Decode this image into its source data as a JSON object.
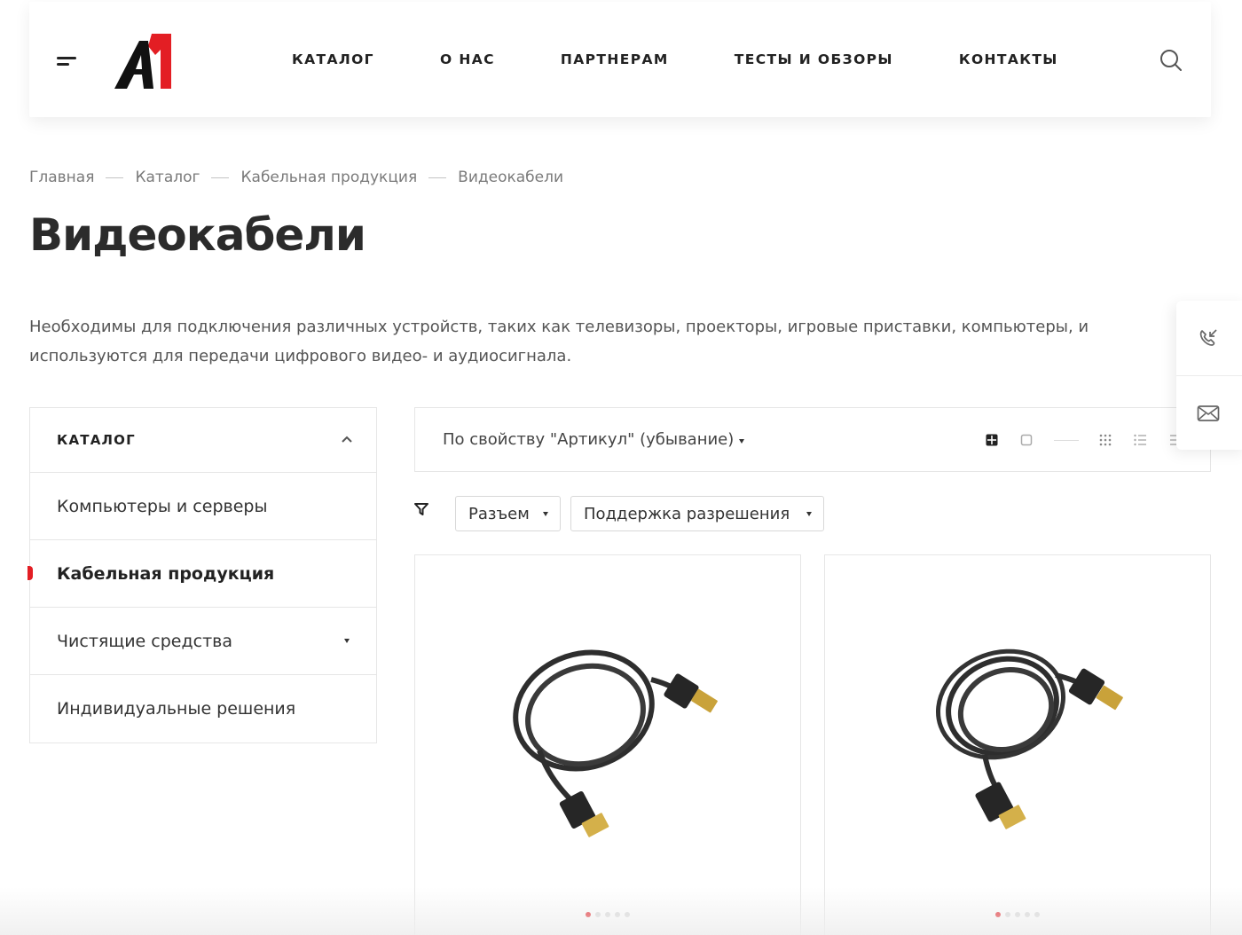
{
  "header": {
    "nav": [
      "КАТАЛОГ",
      "О НАС",
      "ПАРТНЕРАМ",
      "ТЕСТЫ И ОБЗОРЫ",
      "КОНТАКТЫ"
    ],
    "logo_text": "A1"
  },
  "breadcrumb": [
    "Главная",
    "Каталог",
    "Кабельная продукция",
    "Видеокабели"
  ],
  "page": {
    "title": "Видеокабели",
    "description": "Необходимы для подключения различных устройств, таких как телевизоры, проекторы, игровые приставки, компьютеры, и используются для передачи цифрового видео- и аудиосигнала."
  },
  "catalog": {
    "title": "КАТАЛОГ",
    "items": [
      "Компьютеры и серверы",
      "Кабельная продукция",
      "Чистящие средства",
      "Индивидуальные решения"
    ],
    "active_item": "Кабельная продукция"
  },
  "sort": {
    "label": "По свойству \"Артикул\" (убывание)"
  },
  "filters": [
    "Разъем",
    "Поддержка разрешения"
  ],
  "products": [
    {
      "image": "displayport-hdmi-cable",
      "slides": 5,
      "active_slide": 1
    },
    {
      "image": "displayport-displayport-cable",
      "slides": 5,
      "active_slide": 1
    }
  ],
  "colors": {
    "accent": "#e31e24",
    "text": "#2b2b2b"
  }
}
